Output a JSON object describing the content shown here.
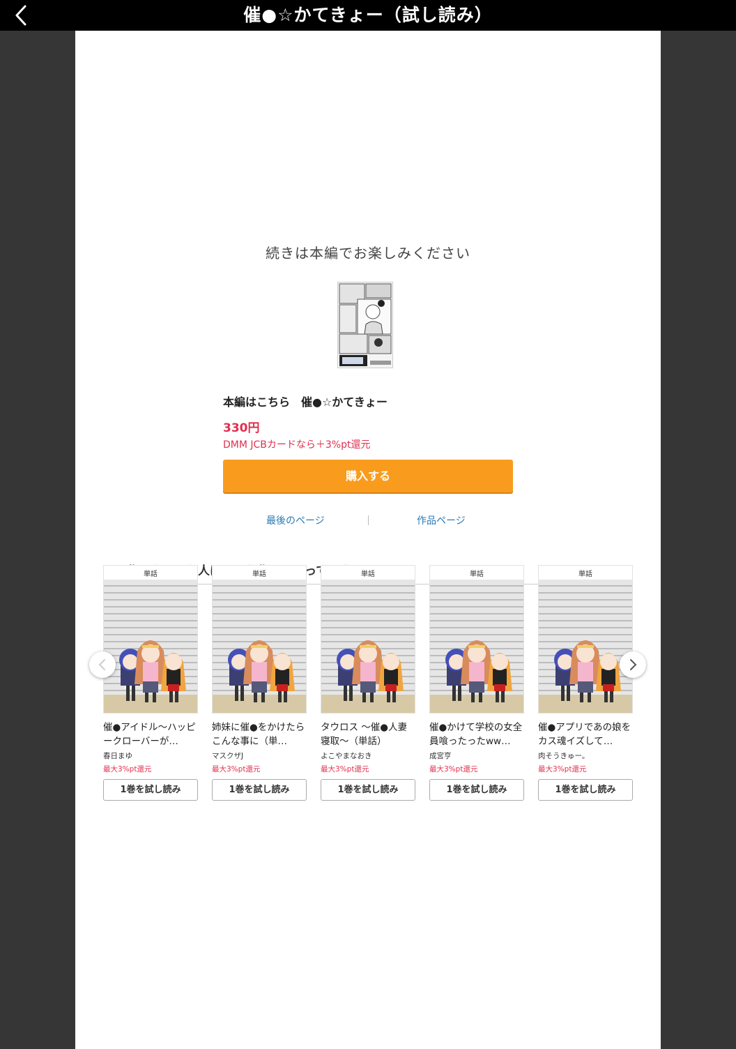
{
  "header": {
    "title": "催●☆かてきょー（試し読み）",
    "back_icon": "chevron-left-icon"
  },
  "end_screen": {
    "continue_text": "続きは本編でお楽しみください",
    "product_title": "本編はこちら　催●☆かてきょー",
    "price": "330円",
    "campaign": "DMM JCBカードなら＋3%pt還元",
    "buy_label": "購入する",
    "last_page_link": "最後のページ",
    "work_page_link": "作品ページ"
  },
  "recommend": {
    "heading": "この作品を買った人はこんな作品も買っています",
    "items": [
      {
        "tag": "単話",
        "title": "催●アイドル〜ハッピークローバーが…",
        "author": "春日まゆ",
        "points": "最大3%pt還元",
        "button": "1巻を試し読み"
      },
      {
        "tag": "単話",
        "title": "姉妹に催●をかけたらこんな事に（単…",
        "author": "マスクザJ",
        "points": "最大3%pt還元",
        "button": "1巻を試し読み"
      },
      {
        "tag": "単話",
        "title": "タウロス 〜催●人妻寝取〜（単話）",
        "author": "よこやまなおき",
        "points": "最大3%pt還元",
        "button": "1巻を試し読み"
      },
      {
        "tag": "単話",
        "title": "催●かけて学校の女全員喰ったったww…",
        "author": "成宮亨",
        "points": "最大3%pt還元",
        "button": "1巻を試し読み"
      },
      {
        "tag": "単話",
        "title": "催●アプリであの娘をカス魂イズして…",
        "author": "肉そうきゅー。",
        "points": "最大3%pt還元",
        "button": "1巻を試し読み"
      }
    ],
    "prev_icon": "chevron-left-icon",
    "next_icon": "chevron-right-icon"
  },
  "colors": {
    "accent_button": "#f99c1e",
    "price_red": "#e0304e",
    "link_blue": "#2a7ab5"
  }
}
